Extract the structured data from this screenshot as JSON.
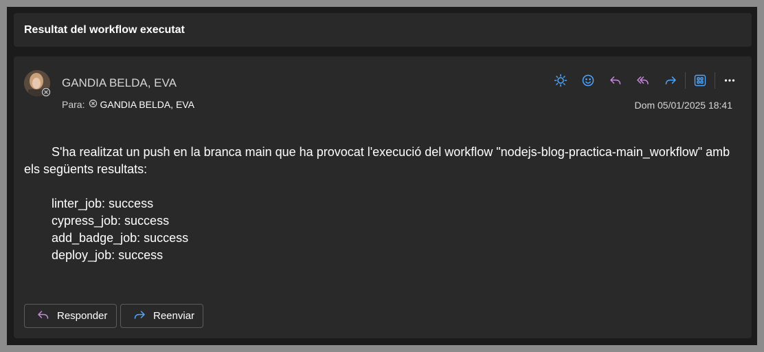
{
  "subject": "Resultat del workflow executat",
  "sender": "GANDIA BELDA, EVA",
  "to_label": "Para:",
  "recipient": "GANDIA BELDA, EVA",
  "date": "Dom 05/01/2025 18:41",
  "body": {
    "paragraph": "S'ha realitzat un push en la branca main que ha provocat l'execució del workflow \"nodejs-blog-practica-main_workflow\" amb els següents resultats:",
    "results": [
      "linter_job: success",
      "cypress_job: success",
      "add_badge_job: success",
      "deploy_job: success"
    ]
  },
  "actions": {
    "reply_label": "Responder",
    "forward_label": "Reenviar"
  },
  "toolbar_icons": [
    "brightness-icon",
    "emoji-icon",
    "reply-icon",
    "reply-all-icon",
    "forward-icon",
    "apps-icon",
    "more-icon"
  ],
  "colors": {
    "accent_blue": "#4ea6ff",
    "accent_purple": "#c78bdc"
  }
}
